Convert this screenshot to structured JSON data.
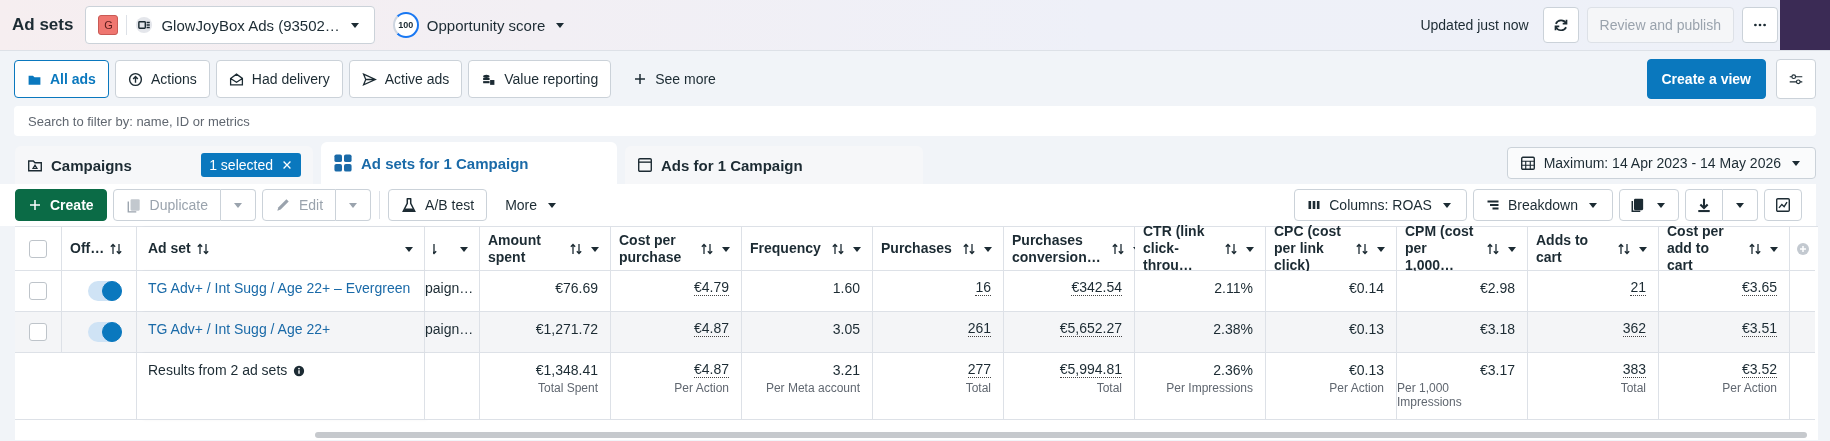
{
  "header": {
    "title": "Ad sets",
    "account_badge": "G",
    "account_name": "GlowJoyBox Ads (93502…",
    "score": "100",
    "score_label": "Opportunity score",
    "updated": "Updated just now",
    "review": {
      "label": "Review and publish",
      "disabled": true
    }
  },
  "filters": {
    "chips": [
      {
        "label": "All ads",
        "selected": true
      },
      {
        "label": "Actions",
        "selected": false
      },
      {
        "label": "Had delivery",
        "selected": false
      },
      {
        "label": "Active ads",
        "selected": false
      },
      {
        "label": "Value reporting",
        "selected": false
      }
    ],
    "see_more": "See more",
    "create_view": "Create a view"
  },
  "search": {
    "placeholder": "Search to filter by: name, ID or metrics"
  },
  "level_tabs": [
    {
      "label": "Campaigns",
      "selected": false,
      "badge": "1 selected"
    },
    {
      "label": "Ad sets for 1 Campaign",
      "selected": true
    },
    {
      "label": "Ads for 1 Campaign",
      "selected": false
    }
  ],
  "date_range": "Maximum: 14 Apr 2023 - 14 May 2026",
  "toolbar": {
    "create": "Create",
    "duplicate": {
      "label": "Duplicate",
      "disabled": true
    },
    "edit": {
      "label": "Edit",
      "disabled": true
    },
    "ab_test": "A/B test",
    "more": "More",
    "columns": "Columns: ROAS",
    "breakdown": "Breakdown"
  },
  "table": {
    "all_selected": false,
    "columns": [
      {
        "kind": "select"
      },
      {
        "kind": "toggle",
        "label": "Off…"
      },
      {
        "kind": "name",
        "label": "Ad set"
      },
      {
        "kind": "partial"
      },
      {
        "kind": "metric",
        "label": "Amount spent",
        "dotted": false
      },
      {
        "kind": "metric",
        "label": "Cost per purchase",
        "dotted": true
      },
      {
        "kind": "metric",
        "label": "Frequency",
        "dotted": false
      },
      {
        "kind": "metric",
        "label": "Purchases",
        "dotted": true
      },
      {
        "kind": "metric",
        "label": "Purchases conversion…",
        "dotted": true
      },
      {
        "kind": "metric",
        "label": "CTR (link click-throu…",
        "dotted": false
      },
      {
        "kind": "metric",
        "label": "CPC (cost per link click)",
        "dotted": false
      },
      {
        "kind": "metric",
        "label": "CPM (cost per 1,000…",
        "dotted": false
      },
      {
        "kind": "metric",
        "label": "Adds to cart",
        "dotted": true
      },
      {
        "kind": "metric",
        "label": "Cost per add to cart",
        "dotted": true
      }
    ],
    "rows": [
      {
        "selected": false,
        "on": true,
        "name": "TG Adv+ / Int Sugg / Age 22+ – Evergreen",
        "partial": "paign…",
        "cells": [
          "€76.69",
          "€4.79",
          "1.60",
          "16",
          "€342.54",
          "2.11%",
          "€0.14",
          "€2.98",
          "21",
          "€3.65"
        ]
      },
      {
        "selected": false,
        "on": true,
        "name": "TG Adv+ / Int Sugg / Age 22+",
        "partial": "paign…",
        "cells": [
          "€1,271.72",
          "€4.87",
          "3.05",
          "261",
          "€5,652.27",
          "2.38%",
          "€0.13",
          "€3.18",
          "362",
          "€3.51"
        ]
      }
    ],
    "summary": {
      "label": "Results from 2 ad sets",
      "cells": [
        {
          "value": "€1,348.41",
          "note": "Total Spent"
        },
        {
          "value": "€4.87",
          "note": "Per Action"
        },
        {
          "value": "3.21",
          "note": "Per Meta account"
        },
        {
          "value": "277",
          "note": "Total"
        },
        {
          "value": "€5,994.81",
          "note": "Total"
        },
        {
          "value": "2.36%",
          "note": "Per Impressions"
        },
        {
          "value": "€0.13",
          "note": "Per Action"
        },
        {
          "value": "€3.17",
          "note": "Per 1,000 Impressions"
        },
        {
          "value": "383",
          "note": "Total"
        },
        {
          "value": "€3.52",
          "note": "Per Action"
        }
      ]
    }
  }
}
